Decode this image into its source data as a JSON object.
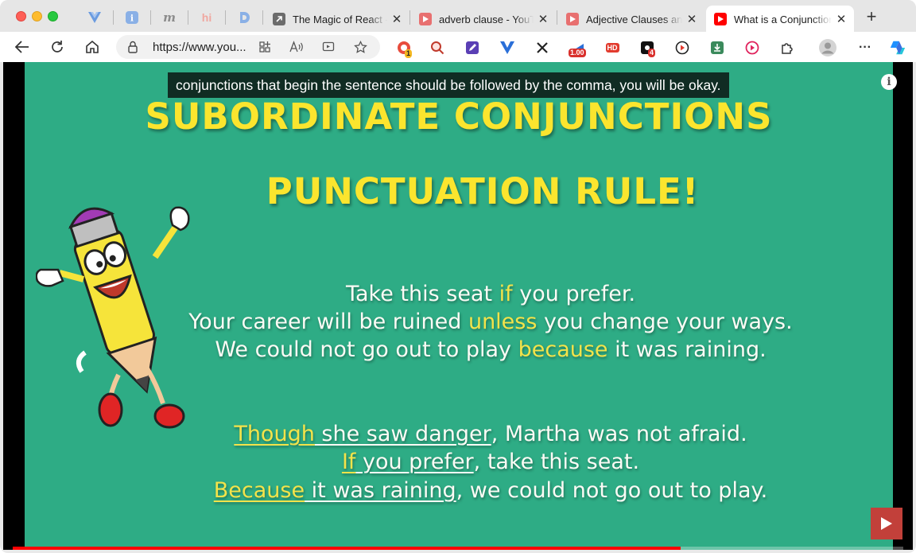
{
  "browser": {
    "tabs": [
      {
        "title": "The Magic of React -",
        "close": "✕"
      },
      {
        "title": "adverb clause - YouTube",
        "close": "✕"
      },
      {
        "title": "Adjective Clauses and",
        "close": "✕"
      },
      {
        "title": "What is a Conjunction",
        "close": "✕",
        "active": true
      }
    ],
    "pinned_tabs": [
      "vue-icon",
      "info-icon",
      "m-icon",
      "hi-icon",
      "d-icon"
    ],
    "new_tab": "+",
    "address": {
      "url": "https://www.you..."
    },
    "extensions": {
      "badge_1": "1",
      "badge_speed": "1.00",
      "badge_hd": "HD",
      "badge_4": "4"
    },
    "menu": "···"
  },
  "video": {
    "caption": "conjunctions that begin the sentence should  be followed by the comma, you will be okay.",
    "info": "i",
    "progress": 0.75,
    "slide": {
      "title1": "SUBORDINATE CONJUNCTIONS",
      "title2": "PUNCTUATION RULE!",
      "examples_a": [
        {
          "pre": "Take this seat ",
          "conj": "if",
          "post": " you prefer."
        },
        {
          "pre": "Your career will be ruined ",
          "conj": "unless",
          "post": " you change your ways."
        },
        {
          "pre": "We could not go out to play ",
          "conj": "because",
          "post": " it was raining."
        }
      ],
      "examples_b": [
        {
          "conj": "Though",
          "clause": " she saw danger",
          "post": ", Martha was not afraid."
        },
        {
          "conj": "If",
          "clause": " you prefer",
          "post": ", take this seat."
        },
        {
          "conj": "Because",
          "clause": " it was raining",
          "post": ", we could not go out to play."
        }
      ]
    }
  },
  "colors": {
    "slide_bg": "#2eac85",
    "heading": "#fbe52e",
    "highlight": "#f3e34a",
    "progress": "#ff0000"
  }
}
